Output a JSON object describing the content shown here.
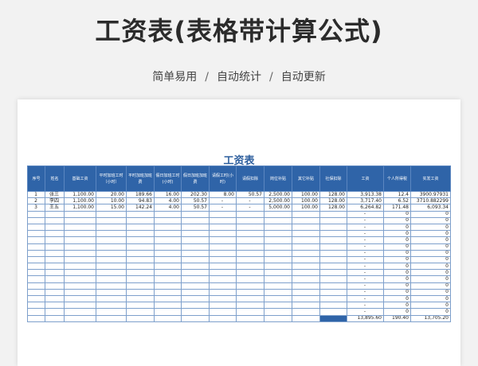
{
  "header": {
    "title": "工资表(表格带计算公式)",
    "features": [
      "简单易用",
      "自动统计",
      "自动更新"
    ]
  },
  "sheet": {
    "title": "工资表",
    "columns": [
      "序号",
      "姓名",
      "基础工资",
      "平时加班工时（小时）",
      "平时加班加班费",
      "假日加班工时(小时)",
      "假日加班加班费",
      "请假工时(小时)",
      "请假扣除",
      "岗位补贴",
      "其它补贴",
      "社保扣除",
      "工资",
      "个人所得税",
      "实发工资"
    ],
    "rows": [
      [
        "1",
        "张三",
        "1,100.00",
        "20.00",
        "189.66",
        "16.00",
        "202.30",
        "8.00",
        "50.57",
        "2,500.00",
        "100.00",
        "128.00",
        "3,913.38",
        "12.4",
        "3900.97931"
      ],
      [
        "2",
        "李四",
        "1,100.00",
        "10.00",
        "94.83",
        "4.00",
        "50.57",
        "-",
        "-",
        "2,500.00",
        "100.00",
        "128.00",
        "3,717.40",
        "6.52",
        "3710.882299"
      ],
      [
        "3",
        "王五",
        "1,100.00",
        "15.00",
        "142.24",
        "4.00",
        "50.57",
        "-",
        "-",
        "5,000.00",
        "100.00",
        "128.00",
        "6,264.82",
        "171.48",
        "6,093.34"
      ]
    ],
    "empty_row_values": {
      "salary": "-",
      "tax": "0",
      "net": "0"
    },
    "empty_row_count": 16,
    "totals": {
      "salary": "13,895.60",
      "tax": "190.40",
      "net": "13,705.20"
    },
    "colors": {
      "header_bg": "#2f64a8",
      "title": "#2e5f9e",
      "grid": "#7ea0cc"
    }
  }
}
